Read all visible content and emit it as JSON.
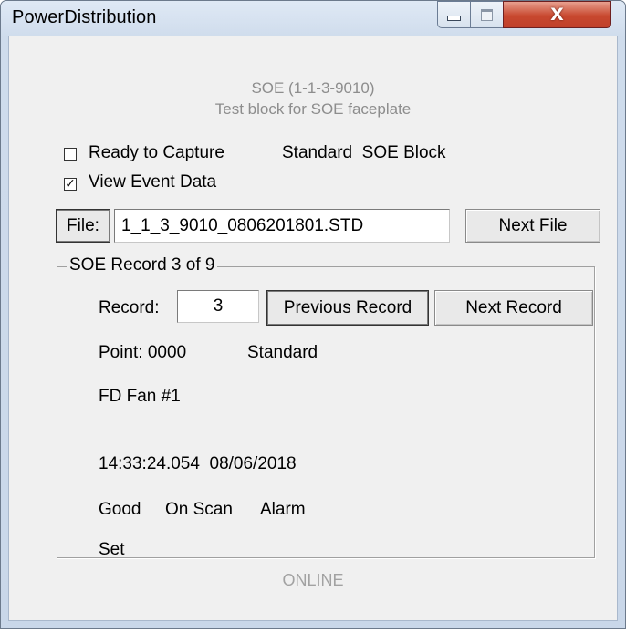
{
  "window": {
    "title": "PowerDistribution",
    "close_label": "X"
  },
  "header": {
    "line1": "SOE (1-1-3-9010)",
    "line2": "Test block for SOE faceplate"
  },
  "capture": {
    "ready_label": "Ready to Capture",
    "ready_checked": false,
    "type_text": "Standard  SOE Block",
    "view_label": "View Event Data",
    "view_checked": true,
    "check_mark": "✓"
  },
  "file": {
    "button_label": "File:",
    "filename": "1_1_3_9010_0806201801.STD",
    "next_file_label": "Next File"
  },
  "record": {
    "group_title": "SOE Record 3 of 9",
    "record_label": "Record:",
    "record_value": "3",
    "previous_label": "Previous Record",
    "next_label": "Next Record",
    "point_text": "Point:  0000",
    "point_type": "Standard",
    "description": "FD Fan #1",
    "timestamp": "14:33:24.054  08/06/2018",
    "quality": "Good",
    "scan": "On Scan",
    "alarm": "Alarm",
    "state": "Set"
  },
  "status": {
    "text": "ONLINE"
  },
  "colors": {
    "status_text": "#a2a2a2",
    "close_button": "#c8482f",
    "client_bg": "#f0f0f0"
  }
}
